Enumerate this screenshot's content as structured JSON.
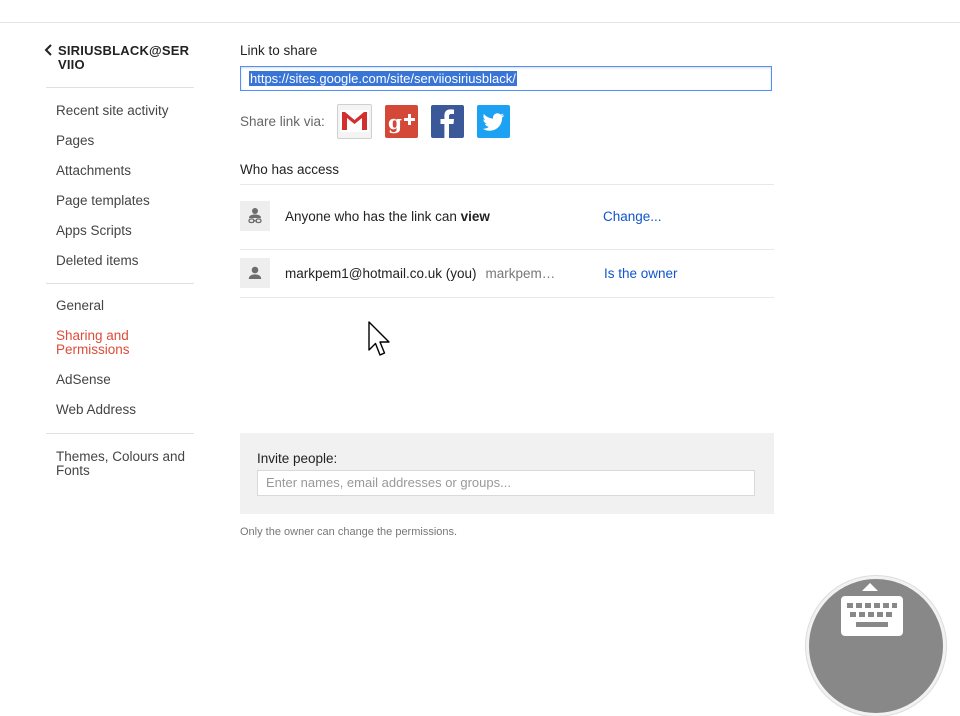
{
  "sidebar": {
    "site_title": "SIRIUSBLACK@SERVIIO",
    "group1": [
      "Recent site activity",
      "Pages",
      "Attachments",
      "Page templates",
      "Apps Scripts",
      "Deleted items"
    ],
    "group2": [
      "General",
      "Sharing and Permissions",
      "AdSense",
      "Web Address"
    ],
    "group3": [
      "Themes, Colours and Fonts"
    ],
    "active_item": "Sharing and Permissions"
  },
  "link_section": {
    "label": "Link to share",
    "url": "https://sites.google.com/site/serviiosiriusblack/"
  },
  "share_via": {
    "label": "Share link via:",
    "services": [
      {
        "name": "Gmail",
        "icon": "gmail-icon",
        "color": "#ffffff"
      },
      {
        "name": "Google+",
        "icon": "google-plus-icon",
        "color": "#d34836"
      },
      {
        "name": "Facebook",
        "icon": "facebook-icon",
        "color": "#3b5998"
      },
      {
        "name": "Twitter",
        "icon": "twitter-icon",
        "color": "#1da1f2"
      }
    ]
  },
  "who_has_access": {
    "title": "Who has access",
    "rows": [
      {
        "text": "Anyone who has the link can",
        "emphasis": "view",
        "action": "Change...",
        "icon": "link-person-icon"
      },
      {
        "text": "markpem1@hotmail.co.uk (you)",
        "sub": "markpem…",
        "action": "Is the owner",
        "icon": "person-icon"
      }
    ]
  },
  "invite": {
    "label": "Invite people:",
    "placeholder": "Enter names, email addresses or groups..."
  },
  "footer_note": "Only the owner can change the permissions.",
  "colors": {
    "accent_link": "#1155cc",
    "active_nav": "#dd4b39",
    "selection": "#3875d7"
  }
}
